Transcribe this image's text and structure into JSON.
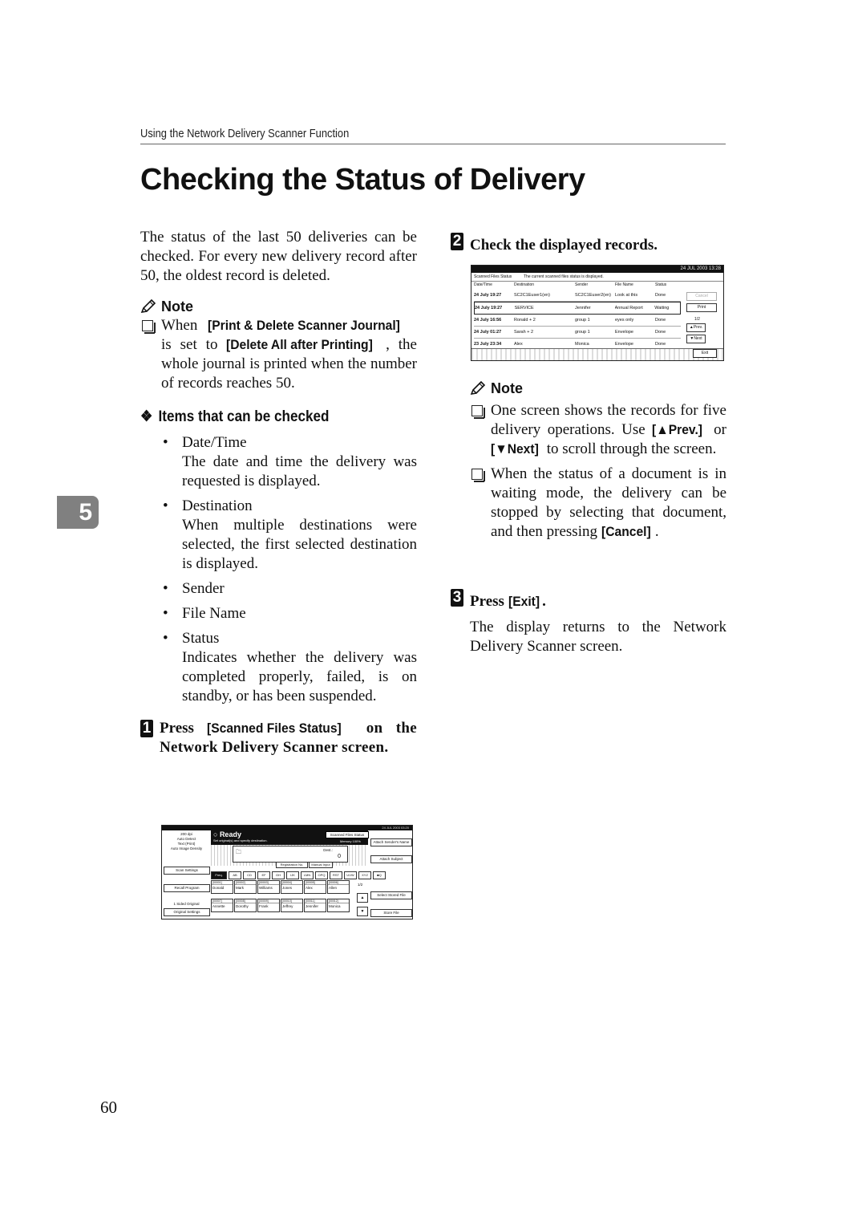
{
  "running_header": "Using the Network Delivery Scanner Function",
  "title": "Checking the Status of Delivery",
  "chapter_tab": "5",
  "page_number": "60",
  "left": {
    "intro": "The status of the last 50 deliveries can be checked. For every new delivery record after 50, the oldest record is deleted.",
    "note": {
      "heading": "Note",
      "item": {
        "t1": "When ",
        "b1": "[Print & Delete Scanner Journal]",
        "t2": " is set to ",
        "b2": "[Delete All after Printing]",
        "t3": ", the whole journal is printed when the number of records reaches 50."
      }
    },
    "items_heading": "Items that can be checked",
    "items": [
      {
        "label": "Date/Time",
        "desc": "The date and time the delivery was requested is displayed."
      },
      {
        "label": "Destination",
        "desc": "When multiple destinations were selected, the first selected destination is displayed."
      },
      {
        "label": "Sender",
        "desc": ""
      },
      {
        "label": "File Name",
        "desc": ""
      },
      {
        "label": "Status",
        "desc": "Indicates whether the delivery was completed properly, failed, is on standby, or has been suspended."
      }
    ],
    "step1": {
      "num": "1",
      "t1": "Press ",
      "b1": "[Scanned Files Status]",
      "t2": " on the Network Delivery Scanner screen."
    }
  },
  "right": {
    "step2": {
      "num": "2",
      "text": "Check the displayed records."
    },
    "note": {
      "heading": "Note",
      "item1": {
        "t1": "One screen shows the records for five delivery operations. Use ",
        "b1": "[▲Prev.]",
        "t2": " or ",
        "b2": "[▼Next]",
        "t3": " to scroll through the screen."
      },
      "item2": {
        "t1": "When the status of a document is in waiting mode, the delivery can be stopped by selecting that document, and then pressing ",
        "b1": "[Cancel]",
        "t2": "."
      }
    },
    "step3": {
      "num": "3",
      "t1": "Press ",
      "b1": "[Exit]",
      "t2": "."
    },
    "step3_desc": "The display returns to the Network Delivery Scanner screen."
  },
  "status_screen": {
    "datetime": "24 JUL 2003 13:28",
    "title": "Scanned Files Status",
    "message": "The current scanned files status is displayed.",
    "columns": [
      "Date/Time",
      "Destination",
      "Sender",
      "File Name",
      "Status"
    ],
    "rows": [
      {
        "date": "24 July 19:27",
        "dest": "SC2C1Euser1(en)",
        "sender": "SC2C1Euser2(en)",
        "file": "Look at this",
        "status": "Done"
      },
      {
        "date": "24 July 19:27",
        "dest": "SERVICE",
        "sender": "Jennifer",
        "file": "Annual Report",
        "status": "Waiting"
      },
      {
        "date": "24 July 16:56",
        "dest": "Ronald  + 2",
        "sender": "group 1",
        "file": "eyes only",
        "status": "Done"
      },
      {
        "date": "24 July 01:27",
        "dest": "Sarah  + 2",
        "sender": "group 1",
        "file": "Envelope",
        "status": "Done"
      },
      {
        "date": "23 July 23:34",
        "dest": "Alex",
        "sender": "Monica",
        "file": "Envelope",
        "status": "Done"
      }
    ],
    "buttons": {
      "cancel": "Cancel",
      "print": "Print",
      "prev": "▲Prev.",
      "next": "▼Next",
      "exit": "Exit"
    },
    "page": "1/2"
  },
  "ready_screen": {
    "datetime": "24 JUL 2003 03:20",
    "settings": [
      "200 dpi",
      "Auto Detect",
      "Text (Print)",
      "Auto Image Density"
    ],
    "ready": "Ready",
    "instruction": "Set original(s) and specify destination.",
    "scanned_files_status": "Scanned Files Status",
    "memory": "Memory 100%",
    "dest_label": "Dest.:",
    "dest_count": "0",
    "registration_no": "Registration No.",
    "manual_input": "Manual Input",
    "left_buttons": {
      "scan_settings": "Scan Settings",
      "recall_program": "Recall Program",
      "sided": "1 Sided Original",
      "original_settings": "Original Settings"
    },
    "right_buttons": {
      "attach_sender": "Attach Sender's Name",
      "attach_subject": "Attach Subject",
      "select_stored": "Select Stored File",
      "store_file": "Store File"
    },
    "tabs": [
      "Freq.",
      "AB",
      "CD",
      "EF",
      "GH",
      "IJK",
      "LMN",
      "OPQ",
      "RST",
      "UVW",
      "XYZ",
      "■Q"
    ],
    "entries": [
      {
        "num": "[00001]",
        "name": "Donald"
      },
      {
        "num": "[00002]",
        "name": "Mark"
      },
      {
        "num": "[00003]",
        "name": "Williams"
      },
      {
        "num": "[00004]",
        "name": "Jones"
      },
      {
        "num": "[00005]",
        "name": "Alex"
      },
      {
        "num": "[00006]",
        "name": "Allen"
      },
      {
        "num": "[00007]",
        "name": "Annette"
      },
      {
        "num": "[00008]",
        "name": "Dorothy"
      },
      {
        "num": "[00009]",
        "name": "Frank"
      },
      {
        "num": "[00010]",
        "name": "Jeffrey"
      },
      {
        "num": "[00011]",
        "name": "Jennifer"
      },
      {
        "num": "[00012]",
        "name": "Monica"
      }
    ],
    "page": "1/2",
    "up": "▲",
    "down": "▼"
  }
}
